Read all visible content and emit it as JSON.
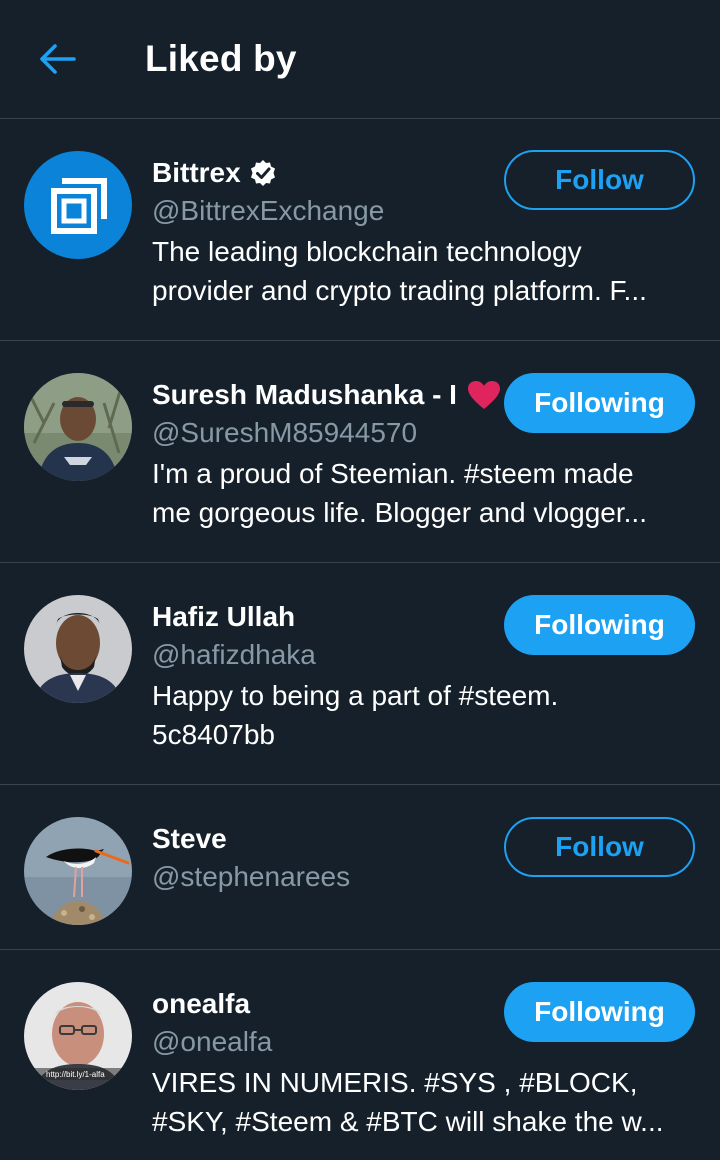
{
  "header": {
    "title": "Liked by",
    "back_icon": "arrow-left-icon"
  },
  "colors": {
    "background": "#15202b",
    "accent": "#1da1f2",
    "secondary_text": "#8899a6",
    "divider": "#38444d"
  },
  "users": [
    {
      "name": "Bittrex",
      "handle": "@BittrexExchange",
      "verified": true,
      "bio_lines": [
        "The leading blockchain technology",
        "provider and crypto trading platform. F..."
      ],
      "button": "Follow"
    },
    {
      "name": "Suresh Madushanka - I",
      "handle": "@SureshM85944570",
      "emoji": "red-heart-icon",
      "bio_lines": [
        "I'm a proud of Steemian. #steem made",
        "me gorgeous life.  Blogger and vlogger..."
      ],
      "button": "Following"
    },
    {
      "name": "Hafiz Ullah",
      "handle": "@hafizdhaka",
      "bio_lines": [
        "Happy to being a part of #steem.",
        "5c8407bb"
      ],
      "button": "Following"
    },
    {
      "name": "Steve",
      "handle": "@stephenarees",
      "bio_lines": [],
      "button": "Follow"
    },
    {
      "name": "onealfa",
      "handle": "@onealfa",
      "avatar_caption": "http://bit.ly/1-alfa",
      "bio_lines": [
        "VIRES IN NUMERIS. #SYS , #BLOCK,",
        "#SKY, #Steem & #BTC will shake the w..."
      ],
      "button": "Following"
    }
  ]
}
